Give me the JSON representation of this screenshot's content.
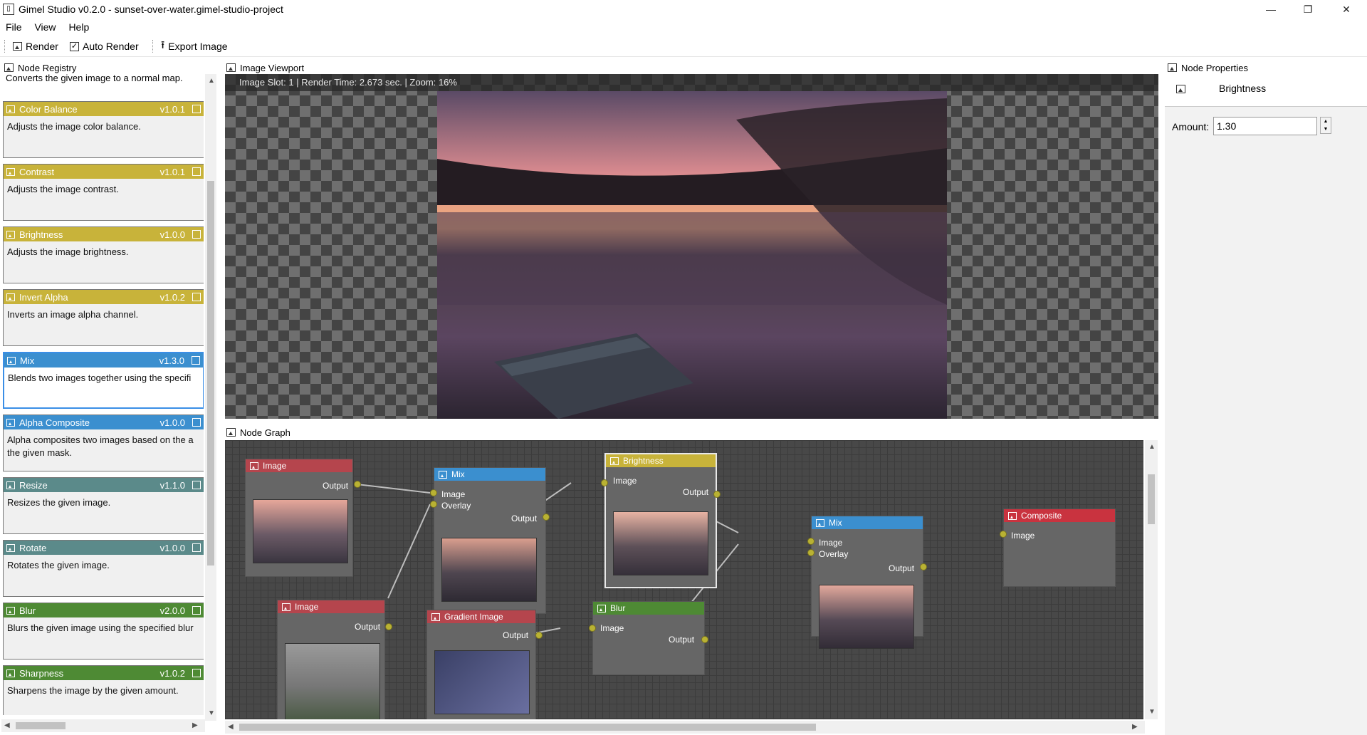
{
  "window": {
    "title": "Gimel Studio v0.2.0 - sunset-over-water.gimel-studio-project",
    "app_icon": "document-icon",
    "min_symbol": "—",
    "restore_symbol": "❐",
    "close_symbol": "✕"
  },
  "menubar": {
    "items": [
      "File",
      "View",
      "Help"
    ]
  },
  "toolbar": {
    "render_label": "Render",
    "auto_render_label": "Auto Render",
    "auto_render_checked": true,
    "export_label": "Export Image"
  },
  "registry": {
    "title": "Node Registry",
    "partial_top_desc": "Converts the given image to a normal map.",
    "nodes": [
      {
        "name": "Color Balance",
        "version": "v1.0.1",
        "desc": "Adjusts the image color balance.",
        "color": "#c8b33a"
      },
      {
        "name": "Contrast",
        "version": "v1.0.1",
        "desc": "Adjusts the image contrast.",
        "color": "#c8b33a"
      },
      {
        "name": "Brightness",
        "version": "v1.0.0",
        "desc": "Adjusts the image brightness.",
        "color": "#c8b33a"
      },
      {
        "name": "Invert Alpha",
        "version": "v1.0.2",
        "desc": "Inverts an image alpha channel.",
        "color": "#c8b33a"
      },
      {
        "name": "Mix",
        "version": "v1.3.0",
        "desc": "Blends two images together using the specifi",
        "color": "#3b8fcf",
        "selected": true
      },
      {
        "name": "Alpha Composite",
        "version": "v1.0.0",
        "desc": "Alpha composites two images based on the a",
        "desc2": "the given mask.",
        "color": "#3b8fcf"
      },
      {
        "name": "Resize",
        "version": "v1.1.0",
        "desc": "Resizes the given image.",
        "color": "#5b8a8a"
      },
      {
        "name": "Rotate",
        "version": "v1.0.0",
        "desc": "Rotates the given image.",
        "color": "#5b8a8a"
      },
      {
        "name": "Blur",
        "version": "v2.0.0",
        "desc": "Blurs the given image using the specified blur",
        "color": "#4e8a34"
      },
      {
        "name": "Sharpness",
        "version": "v1.0.2",
        "desc": "Sharpens the image by the given amount.",
        "color": "#4e8a34"
      }
    ]
  },
  "viewport": {
    "title": "Image Viewport",
    "info": "Image Slot: 1 | Render Time: 2.673 sec. | Zoom: 16%"
  },
  "graph": {
    "title": "Node Graph",
    "nodes": {
      "image1": {
        "title": "Image",
        "output": "Output",
        "color": "#b5454d"
      },
      "image2": {
        "title": "Image",
        "output": "Output",
        "color": "#b5454d"
      },
      "mix1": {
        "title": "Mix",
        "in1": "Image",
        "in2": "Overlay",
        "output": "Output",
        "color": "#3b8fcf"
      },
      "brightness": {
        "title": "Brightness",
        "in1": "Image",
        "output": "Output",
        "color": "#c8b33a"
      },
      "gradient": {
        "title": "Gradient Image",
        "output": "Output",
        "color": "#b5454d"
      },
      "blur": {
        "title": "Blur",
        "in1": "Image",
        "output": "Output",
        "color": "#4e8a34"
      },
      "mix2": {
        "title": "Mix",
        "in1": "Image",
        "in2": "Overlay",
        "output": "Output",
        "color": "#3b8fcf"
      },
      "composite": {
        "title": "Composite",
        "in1": "Image",
        "color": "#c9333f"
      }
    }
  },
  "properties": {
    "title": "Node Properties",
    "node_name": "Brightness",
    "amount_label": "Amount:",
    "amount_value": "1.30"
  }
}
